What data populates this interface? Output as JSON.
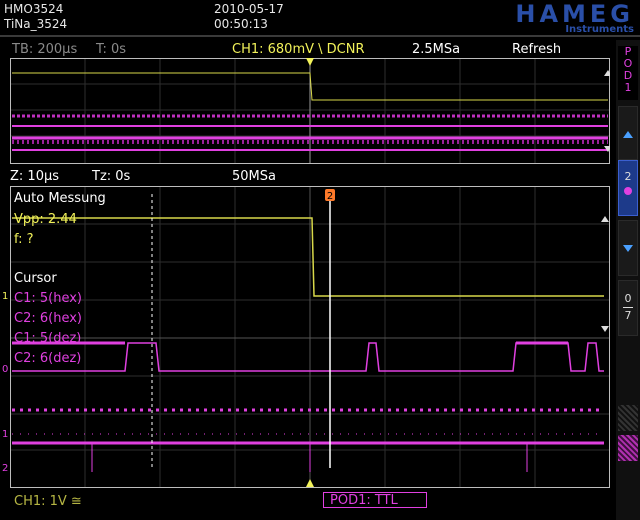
{
  "header": {
    "model": "HMO3524",
    "filename": "TiNa_3524",
    "date": "2010-05-17",
    "time": "00:50:13",
    "brand": "HAMEG",
    "brand_sub": "Instruments"
  },
  "overview_bar": {
    "timebase": "TB: 200µs",
    "trigger_time": "T: 0s",
    "channel_setting": "CH1: 680mV \\ DCNR",
    "sample_rate": "2.5MSa",
    "mode": "Refresh"
  },
  "zoom_bar": {
    "zoom": "Z: 10µs",
    "zoom_time": "Tz: 0s",
    "sample_rate": "50MSa"
  },
  "measurements": {
    "title": "Auto Messung",
    "vpp": "Vpp: 2.44",
    "freq": "f: ?",
    "cursor_title": "Cursor",
    "c1_hex": "C1: 5(hex)",
    "c2_hex": "C2: 6(hex)",
    "c1_dec": "C1: 5(dez)",
    "c2_dec": "C2: 6(dez)"
  },
  "footer": {
    "ch1": "CH1: 1V ≅",
    "pod": "POD1: TTL"
  },
  "sidebar": {
    "pod_label": "POD1",
    "button_2": "2",
    "button_07_top": "0",
    "button_07_bottom": "7"
  },
  "markers": {
    "trace_1": "1",
    "trace_0": "0",
    "bus_1": "1",
    "bus_2": "2",
    "cursor_2": "2"
  },
  "colors": {
    "channel_yellow": "#f2f25a",
    "pod_magenta": "#e040e0",
    "grid": "#3a3a3a",
    "brand_blue": "#2a4fa8",
    "accent_orange": "#ff7a2a"
  }
}
